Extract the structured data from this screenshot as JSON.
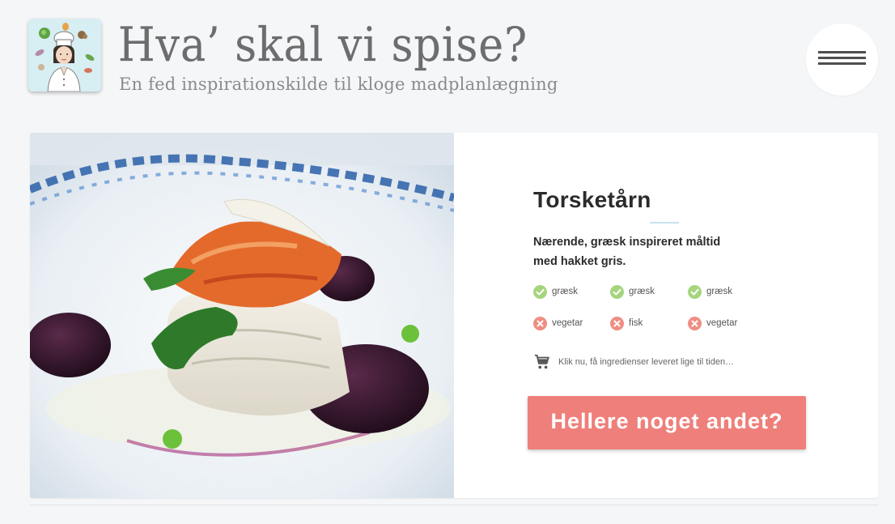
{
  "header": {
    "title": "Hva’ skal vi spise?",
    "subtitle": "En fed inspirationskilde til kloge madplanlægning",
    "logo_icon": "chef-with-vegetables-icon",
    "menu_icon": "hamburger-menu-icon"
  },
  "recipe": {
    "image_icon": "dish-photo",
    "title": "Torsketårn",
    "description": "Nærende, græsk inspireret måltid med hakket gris.",
    "tags": [
      {
        "label": "græsk",
        "status": "yes",
        "icon": "check-icon"
      },
      {
        "label": "græsk",
        "status": "yes",
        "icon": "check-icon"
      },
      {
        "label": "græsk",
        "status": "yes",
        "icon": "check-icon"
      },
      {
        "label": "vegetar",
        "status": "no",
        "icon": "cross-icon"
      },
      {
        "label": "fisk",
        "status": "no",
        "icon": "cross-icon"
      },
      {
        "label": "vegetar",
        "status": "no",
        "icon": "cross-icon"
      }
    ],
    "order_icon": "shopping-cart-icon",
    "order_text": "Klik nu, få ingredienser leveret lige til tiden…",
    "alt_button": "Hellere noget andet?"
  },
  "colors": {
    "background": "#f5f6f8",
    "accent_button": "#ef7f7a",
    "check_green": "#a6d57e",
    "cross_red": "#ee8e82"
  }
}
